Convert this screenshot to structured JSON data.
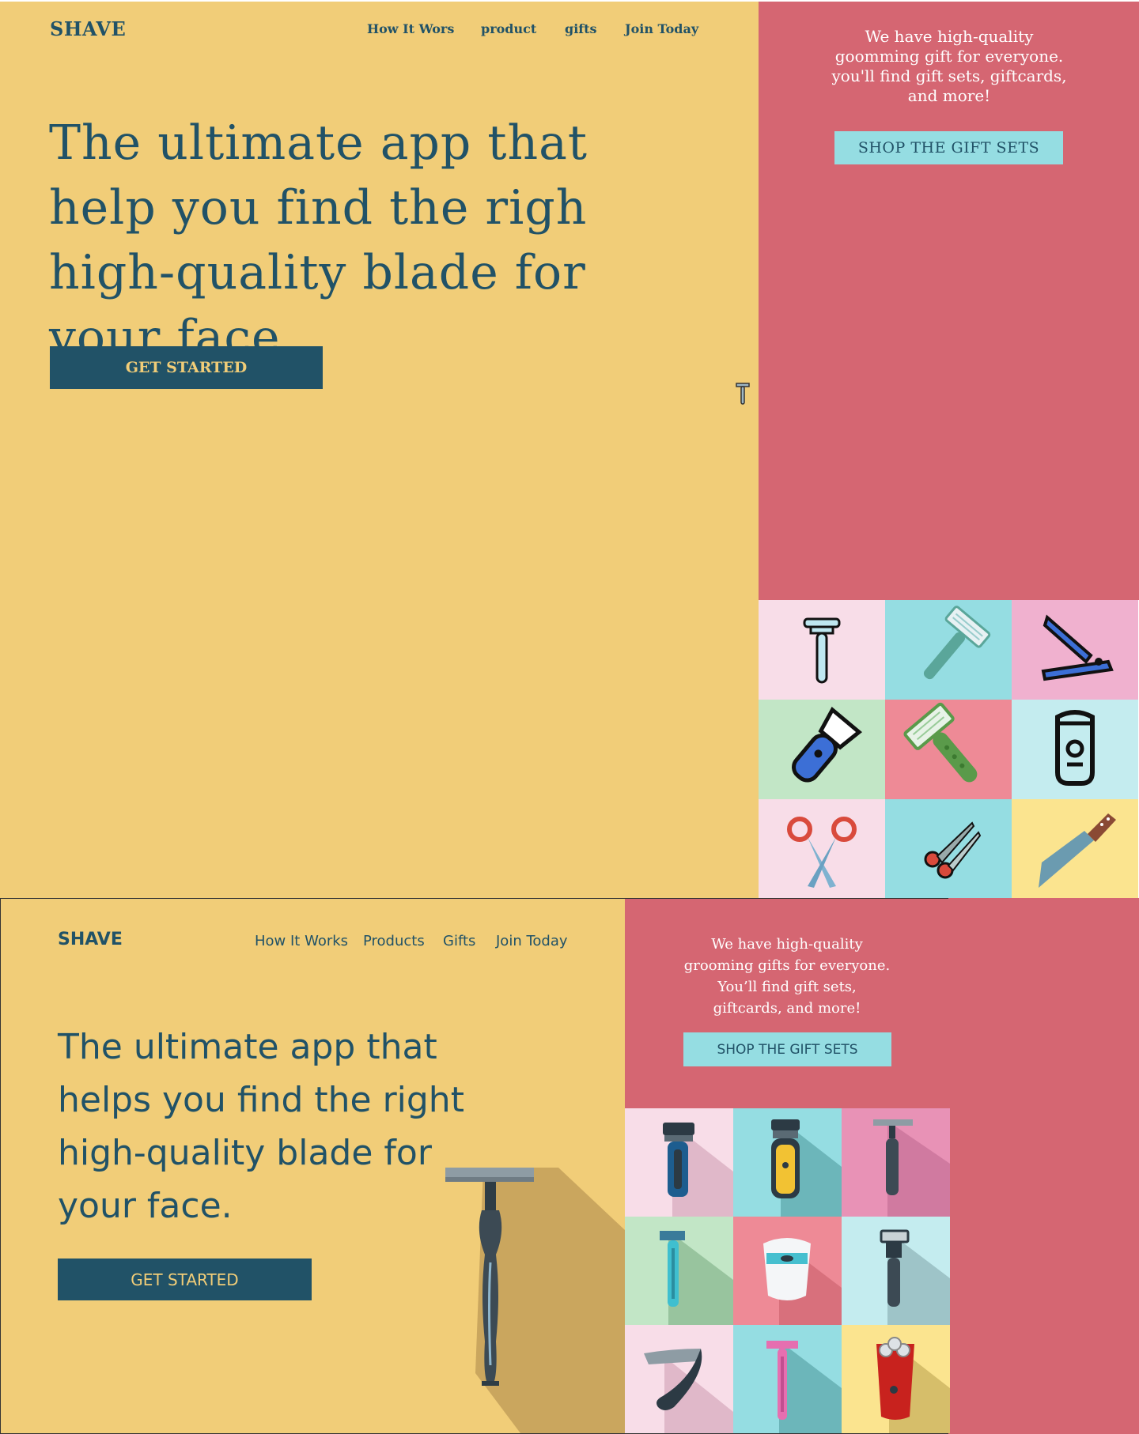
{
  "version_a": {
    "logo": "SHAVE",
    "nav": [
      "How It Wors",
      "product",
      "gifts",
      "Join Today"
    ],
    "headline": "The ultimate app that help you find the righ high-quality blade for your face",
    "cta_label": "GET STARTED",
    "gift_text": "We have high-quality goomming gift for everyone. you'll find gift sets, giftcards, and more!",
    "shop_label": "SHOP THE GIFT SETS",
    "tiles": [
      {
        "icon": "safety-razor-icon",
        "bg": "#f8dde8"
      },
      {
        "icon": "disposable-razor-icon",
        "bg": "#95dde2"
      },
      {
        "icon": "straight-razor-icon",
        "bg": "#f0b1cf"
      },
      {
        "icon": "electric-trimmer-icon",
        "bg": "#c2e6c6"
      },
      {
        "icon": "green-razor-icon",
        "bg": "#ee8a96"
      },
      {
        "icon": "electric-shaver-icon",
        "bg": "#c4ecef"
      },
      {
        "icon": "scissors-icon",
        "bg": "#f8dde8"
      },
      {
        "icon": "small-scissors-icon",
        "bg": "#95dde2"
      },
      {
        "icon": "knife-icon",
        "bg": "#fbe48f"
      }
    ]
  },
  "version_b": {
    "logo": "SHAVE",
    "nav": [
      "How It Works",
      "Products",
      "Gifts",
      "Join Today"
    ],
    "headline_lines": [
      "The ultimate app that",
      "helps you find the right",
      "high-quality blade for",
      "your face."
    ],
    "cta_label": "GET STARTED",
    "gift_lines": [
      "We have high-quality",
      "grooming gifts for everyone.",
      "You’ll find gift sets,",
      "giftcards, and more!"
    ],
    "shop_label": "SHOP THE GIFT SETS",
    "tiles": [
      {
        "icon": "blue-cartridge-razor-icon",
        "bg": "#f8dde8"
      },
      {
        "icon": "yellow-trimmer-icon",
        "bg": "#95dde2"
      },
      {
        "icon": "black-safety-razor-icon",
        "bg": "#e892b6"
      },
      {
        "icon": "teal-disposable-razor-icon",
        "bg": "#c2e6c6"
      },
      {
        "icon": "white-electric-shaver-icon",
        "bg": "#ee8a96"
      },
      {
        "icon": "dark-cartridge-razor-icon",
        "bg": "#c4ecef"
      },
      {
        "icon": "straight-razor-icon",
        "bg": "#f8dde8"
      },
      {
        "icon": "pink-disposable-razor-icon",
        "bg": "#95dde2"
      },
      {
        "icon": "red-rotary-shaver-icon",
        "bg": "#fbe48f"
      }
    ]
  },
  "colors": {
    "yellow": "#f1cd78",
    "pink": "#d56672",
    "navy": "#215267",
    "cyan": "#95dde2"
  }
}
